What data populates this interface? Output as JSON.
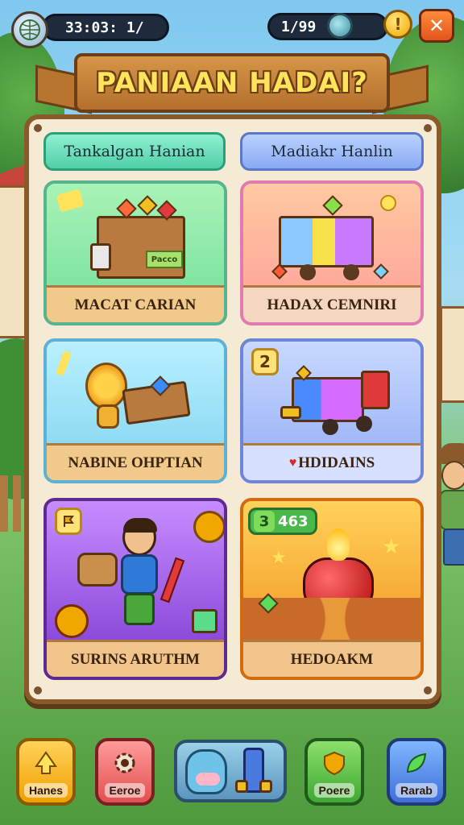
{
  "top_bar": {
    "left_counter": "33:03: 1/",
    "right_counter": "1/99",
    "coin_symbol": "!",
    "close_symbol": "✕"
  },
  "header": {
    "title": "PANIAAN HADAI?"
  },
  "tabs": [
    {
      "label": "Tankalgan Hanian"
    },
    {
      "label": "Madiakr Hanlin"
    }
  ],
  "cards": [
    {
      "label": "MACAT CARIAN",
      "box_text": "Pacco"
    },
    {
      "label": "HADAX CEMNIRI"
    },
    {
      "label": "NABINE OHPTIAN"
    },
    {
      "label": "HDIDAINS",
      "badge": "2"
    },
    {
      "label": "SURINS ARUTHM"
    },
    {
      "label": "HEDOAKM",
      "chip_num": "3",
      "chip_value": "463"
    }
  ],
  "bottom_nav": [
    {
      "label": "Hanes",
      "icon": "arrow-up-icon"
    },
    {
      "label": "Eeroe",
      "icon": "gear-icon"
    },
    {
      "label": "Poere",
      "icon": "shield-icon"
    },
    {
      "label": "Rarab",
      "icon": "leaf-icon"
    }
  ],
  "colors": {
    "panel": "#f5ead3",
    "banner": "#c4823a",
    "title_text": "#ffe35a",
    "close_button": "#e2561a"
  }
}
